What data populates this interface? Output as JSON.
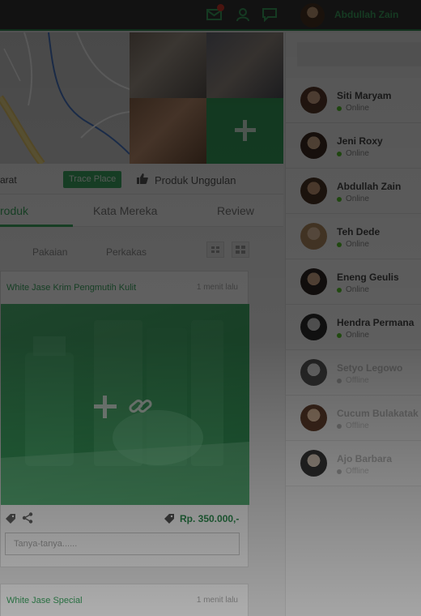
{
  "colors": {
    "accent": "#3ea863",
    "topbar": "#343434",
    "online": "#56c22b",
    "offline": "#bbbbbb",
    "overlay": "#000000"
  },
  "topbar": {
    "icons": [
      "mail-icon",
      "users-icon",
      "chat-icon"
    ],
    "user_name": "Abdullah Zain"
  },
  "location": {
    "label": "arat",
    "trace_label": "Trace Place",
    "featured_label": "Produk Unggulan"
  },
  "tabs": [
    {
      "label": "roduk",
      "active": true
    },
    {
      "label": "Kata Mereka",
      "active": false
    },
    {
      "label": "Review",
      "active": false
    }
  ],
  "filters": [
    "Pakaian",
    "Perkakas"
  ],
  "posts": [
    {
      "title": "White Jase Krim Pengmutih Kulit",
      "time": "1 menit lalu",
      "price": "Rp. 350.000,-",
      "comment_placeholder": "Tanya-tanya......"
    },
    {
      "title": "White Jase Special",
      "time": "1 menit lalu"
    }
  ],
  "users": [
    {
      "name": "Siti Maryam",
      "status": "Online"
    },
    {
      "name": "Jeni Roxy",
      "status": "Online"
    },
    {
      "name": "Abdullah Zain",
      "status": "Online"
    },
    {
      "name": "Teh Dede",
      "status": "Online"
    },
    {
      "name": "Eneng Geulis",
      "status": "Online"
    },
    {
      "name": "Hendra Permana",
      "status": "Online"
    },
    {
      "name": "Setyo Legowo",
      "status": "Offline"
    },
    {
      "name": "Cucum Bulakatak",
      "status": "Offline"
    },
    {
      "name": "Ajo Barbara",
      "status": "Offline"
    }
  ]
}
